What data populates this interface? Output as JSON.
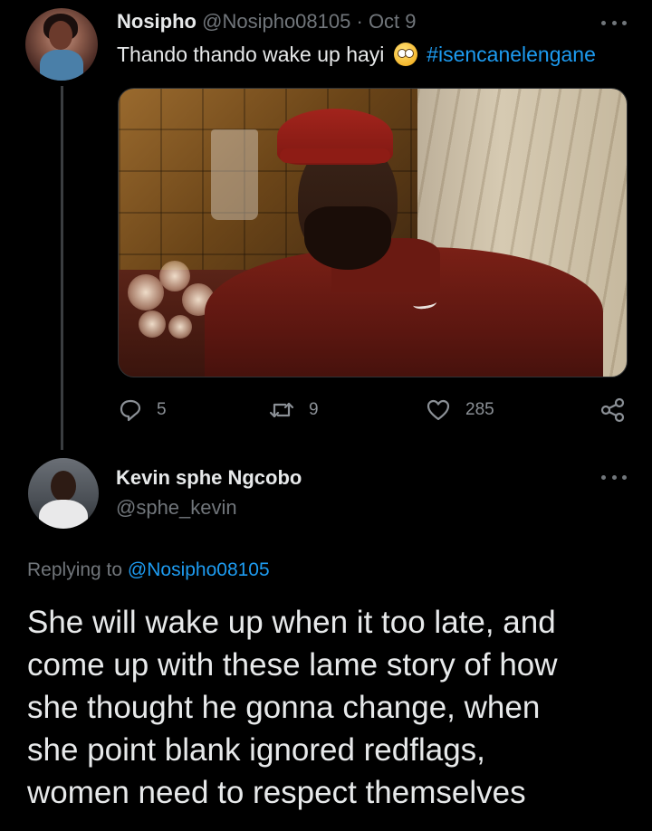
{
  "tweet": {
    "author_name": "Nosipho",
    "author_handle": "@Nosipho08105",
    "separator": "·",
    "date": "Oct 9",
    "text": "Thando thando wake up hayi",
    "emoji": "face-with-rolling-eyes",
    "hashtag": "#isencanelengane",
    "stats": {
      "replies": "5",
      "retweets": "9",
      "likes": "285"
    }
  },
  "reply": {
    "author_name": "Kevin sphe Ngcobo",
    "author_handle": "@sphe_kevin",
    "replying_to_prefix": "Replying to",
    "replying_to_handle": "@Nosipho08105",
    "lines": [
      "She will wake up when it too late, and",
      "come up with these lame story of how",
      "she thought he gonna change, when",
      "she point blank ignored redflags,",
      "women need to respect themselves"
    ]
  },
  "colors": {
    "background": "#000000",
    "text": "#e7e9ea",
    "muted": "#71767b",
    "link": "#1d9bf0"
  },
  "icons": [
    "more-options-icon",
    "reply-icon",
    "retweet-icon",
    "like-icon",
    "share-icon"
  ]
}
